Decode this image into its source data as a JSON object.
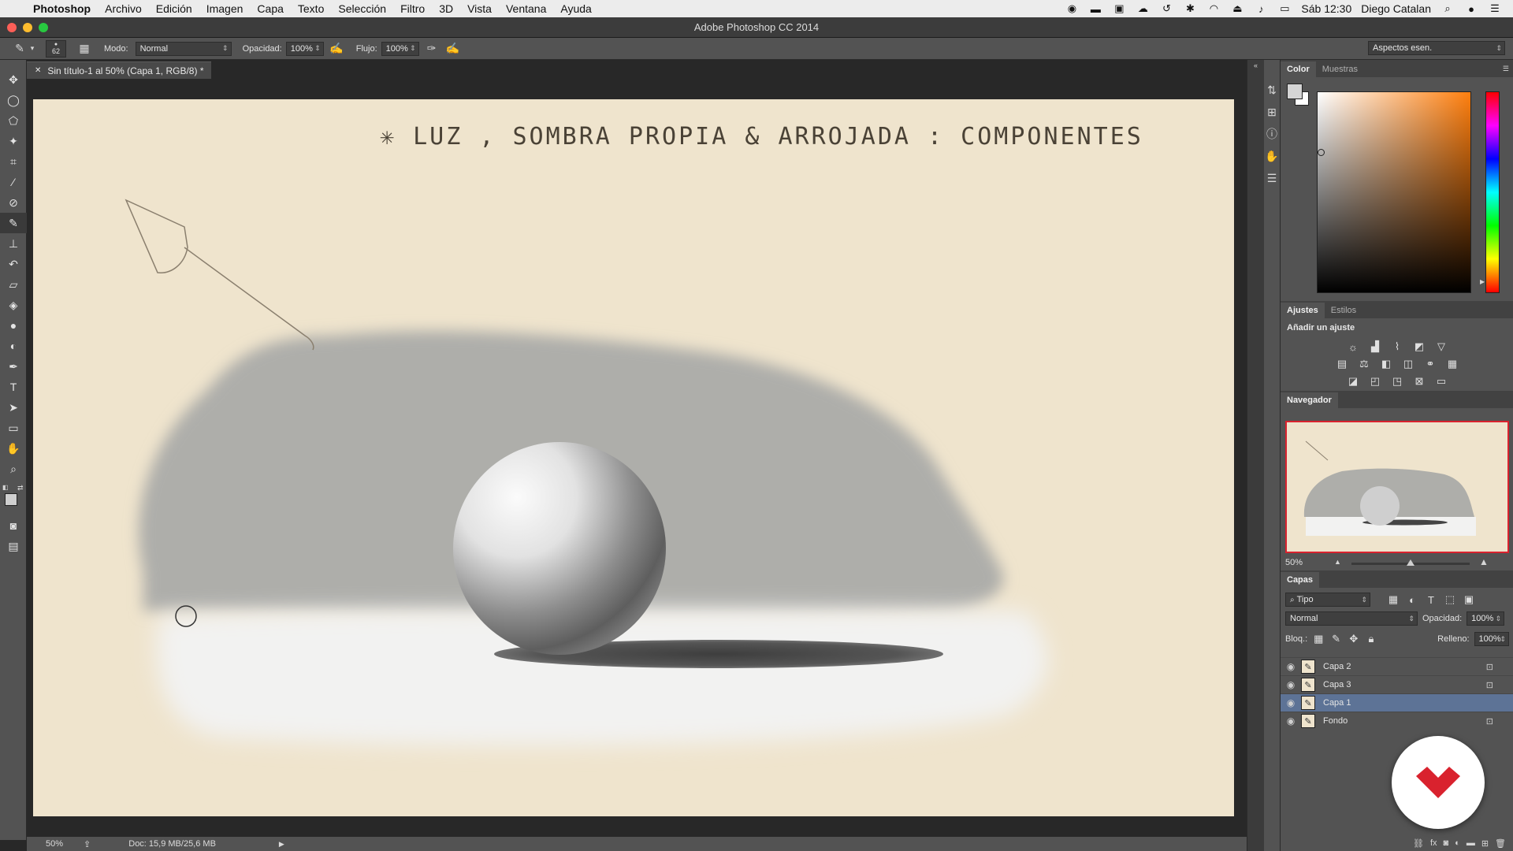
{
  "menubar": {
    "app_name": "Photoshop",
    "items": [
      "Archivo",
      "Edición",
      "Imagen",
      "Capa",
      "Texto",
      "Selección",
      "Filtro",
      "3D",
      "Vista",
      "Ventana",
      "Ayuda"
    ],
    "clock": "Sáb 12:30",
    "user": "Diego Catalan"
  },
  "window": {
    "title": "Adobe Photoshop CC 2014"
  },
  "options": {
    "brush_size": "62",
    "mode_label": "Modo:",
    "mode_value": "Normal",
    "opacity_label": "Opacidad:",
    "opacity_value": "100%",
    "flow_label": "Flujo:",
    "flow_value": "100%",
    "workspace": "Aspectos esen."
  },
  "document": {
    "tab_title": "Sin título-1 al 50% (Capa 1, RGB/8) *",
    "canvas_title": "✳ LUZ , SOMBRA PROPIA & ARROJADA : COMPONENTES"
  },
  "status": {
    "zoom": "50%",
    "doc_info": "Doc: 15,9 MB/25,6 MB"
  },
  "color_panel": {
    "tabs": [
      "Color",
      "Muestras"
    ],
    "active_tab": "Color",
    "hue_color": "#ff7f0e"
  },
  "adjustments_panel": {
    "tabs": [
      "Ajustes",
      "Estilos"
    ],
    "title": "Añadir un ajuste"
  },
  "navigator_panel": {
    "title": "Navegador",
    "zoom": "50%"
  },
  "layers_panel": {
    "title": "Capas",
    "filter": "Tipo",
    "blend_mode": "Normal",
    "opacity_label": "Opacidad:",
    "opacity_value": "100%",
    "lock_label": "Bloq.:",
    "fill_label": "Relleno:",
    "fill_value": "100%",
    "layers": [
      {
        "name": "Capa 2",
        "locked": true,
        "selected": false
      },
      {
        "name": "Capa 3",
        "locked": true,
        "selected": false
      },
      {
        "name": "Capa 1",
        "locked": false,
        "selected": true
      },
      {
        "name": "Fondo",
        "locked": true,
        "selected": false
      }
    ]
  },
  "colors": {
    "accent_selection": "#5d7396",
    "canvas_paper": "#efe4cd",
    "brand_red": "#d9222e"
  },
  "icons": {
    "tools": [
      "move-icon",
      "lasso-icon",
      "polygon-lasso-icon",
      "magic-wand-icon",
      "crop-icon",
      "eyedropper-icon",
      "healing-brush-icon",
      "brush-icon",
      "stamp-icon",
      "history-brush-icon",
      "eraser-icon",
      "paint-bucket-icon",
      "blur-icon",
      "dodge-icon",
      "pen-icon",
      "type-icon",
      "path-select-icon",
      "rectangle-icon",
      "hand-icon",
      "zoom-icon"
    ]
  }
}
